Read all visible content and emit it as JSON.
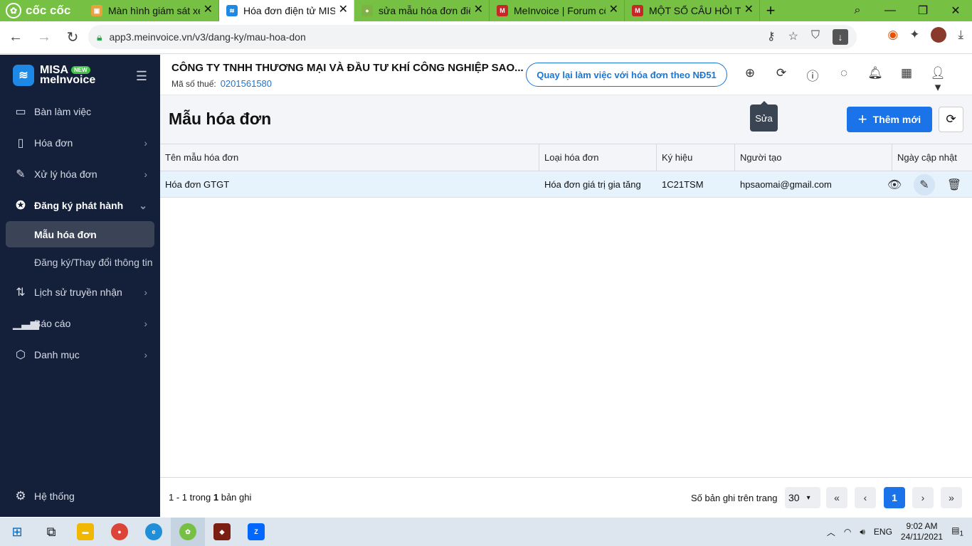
{
  "browser": {
    "brand": "cốc cốc",
    "tabs": [
      {
        "title": "Màn hình giám sát xe",
        "active": false
      },
      {
        "title": "Hóa đơn điện tử MISA",
        "active": true
      },
      {
        "title": "sửa mẫu hóa đơn điện",
        "active": false
      },
      {
        "title": "MeInvoice | Forum cộ",
        "active": false
      },
      {
        "title": "MỘT SỐ CÂU HỎI TH",
        "active": false
      }
    ],
    "url": "app3.meinvoice.vn/v3/dang-ky/mau-hoa-don"
  },
  "app": {
    "logo_top": "MISA",
    "logo_bottom": "meInvoice",
    "logo_badge": "NEW",
    "company": "CÔNG TY TNHH THƯƠNG MẠI VÀ ĐẦU TƯ KHÍ CÔNG NGHIỆP SAO...",
    "tax_label": "Mã số thuế:",
    "tax_code": "0201561580",
    "back_button": "Quay lại làm việc với hóa đơn theo NĐ51"
  },
  "sidebar": {
    "items": [
      {
        "label": "Bàn làm việc",
        "icon": "monitor-icon"
      },
      {
        "label": "Hóa đơn",
        "icon": "document-icon"
      },
      {
        "label": "Xử lý hóa đơn",
        "icon": "edit-document-icon"
      },
      {
        "label": "Đăng ký phát hành",
        "icon": "badge-icon"
      },
      {
        "label": "Lịch sử truyền nhận",
        "icon": "transfer-icon"
      },
      {
        "label": "Báo cáo",
        "icon": "bar-chart-icon"
      },
      {
        "label": "Danh mục",
        "icon": "box-icon"
      }
    ],
    "subitems": [
      "Mẫu hóa đơn",
      "Đăng ký/Thay đổi thông tin"
    ],
    "system": "Hệ thống"
  },
  "page": {
    "title": "Mẫu hóa đơn",
    "add_button": "Thêm mới"
  },
  "table": {
    "columns": [
      "Tên mẫu hóa đơn",
      "Loại hóa đơn",
      "Ký hiệu",
      "Người tạo",
      "Ngày cập nhật"
    ],
    "rows": [
      [
        "Hóa đơn GTGT",
        "Hóa đơn giá trị gia tăng",
        "1C21TSM",
        "hpsaomai@gmail.com"
      ]
    ],
    "tooltip": "Sửa"
  },
  "footer": {
    "count_prefix": "1 - 1 trong ",
    "count_total": "1",
    "count_suffix": " bản ghi",
    "per_page_label": "Số bản ghi trên trang",
    "per_page": "30",
    "current_page": "1"
  },
  "taskbar": {
    "lang": "ENG",
    "time": "9:02 AM",
    "date": "24/11/2021",
    "notif_count": "1"
  }
}
